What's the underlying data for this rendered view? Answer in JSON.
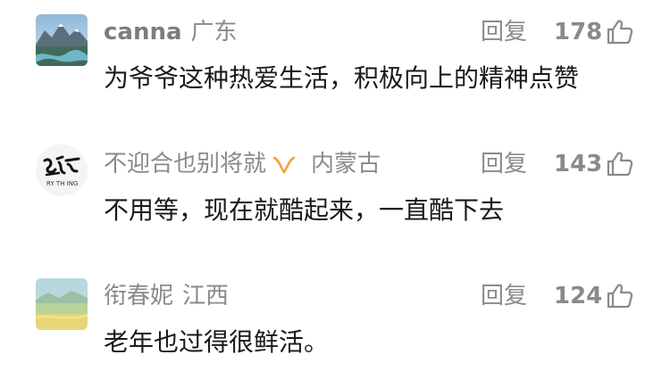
{
  "comments": [
    {
      "username": "canna",
      "location": "广东",
      "reply_label": "回复",
      "likes": "178",
      "text": "为爷爷这种热爱生活，积极向上的精神点赞",
      "avatar": "mountain-lake-photo"
    },
    {
      "username": "不迎合也别将就",
      "location": "内蒙古",
      "reply_label": "回复",
      "likes": "143",
      "text": "不用等，现在就酷起来，一直酷下去",
      "avatar": "calligraphy-logo",
      "avatar_subtext": "RY TH ING",
      "badge": "orange-ribbon-icon",
      "badge_color": "#f2a33a"
    },
    {
      "username": "衔春妮",
      "location": "江西",
      "reply_label": "回复",
      "likes": "124",
      "text": "老年也过得很鲜活。",
      "avatar": "field-landscape-photo"
    }
  ]
}
